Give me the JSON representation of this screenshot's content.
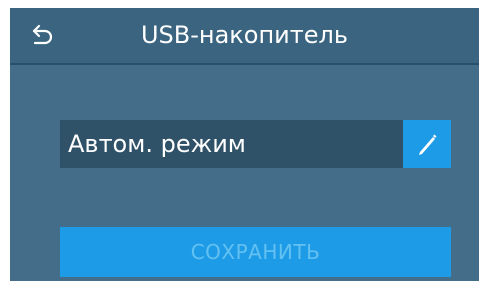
{
  "header": {
    "title": "USB-накопитель",
    "back_icon": "back-arrow-icon"
  },
  "mode_field": {
    "value": "Автом. режим",
    "edit_icon": "pencil-icon"
  },
  "save_button": {
    "label": "СОХРАНИТЬ",
    "enabled": false
  },
  "colors": {
    "background": "#436d88",
    "header": "#3a6480",
    "field": "#2f5269",
    "accent": "#1e9be6",
    "disabled_text": "#63c1f2"
  }
}
